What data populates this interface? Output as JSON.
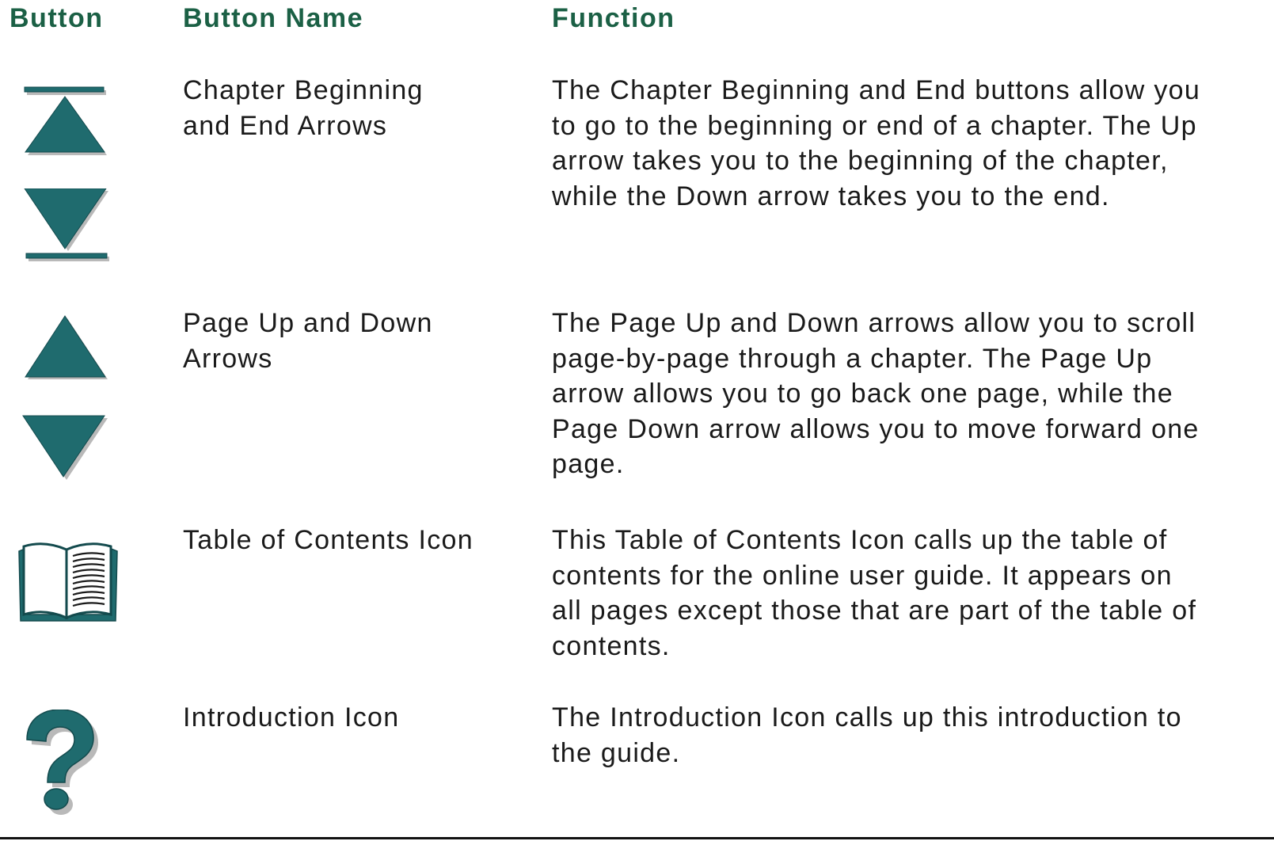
{
  "headers": {
    "button": "Button",
    "name": "Button Name",
    "function": "Function"
  },
  "colors": {
    "header_text": "#1b6045",
    "icon_teal": "#1f6b6e",
    "icon_teal_dark": "#134a4d",
    "icon_shadow": "#b9b9b9"
  },
  "rows": [
    {
      "icons": [
        "chapter-beginning-arrow-icon",
        "chapter-end-arrow-icon"
      ],
      "name_line1": "Chapter Beginning",
      "name_line2": "and End Arrows",
      "function_lines": [
        "The Chapter Beginning and End buttons allow you",
        "to go to the beginning or end of a chapter. The Up",
        "arrow takes you to the beginning of the chapter,",
        "while the Down arrow takes you to the end."
      ]
    },
    {
      "icons": [
        "page-up-arrow-icon",
        "page-down-arrow-icon"
      ],
      "name_line1": "Page Up and Down",
      "name_line2": "Arrows",
      "function_lines": [
        "The Page Up and Down arrows allow you to scroll",
        "page-by-page through a chapter. The Page Up",
        "arrow allows you to go back one page, while the",
        "Page Down arrow allows you to move forward one",
        "page."
      ]
    },
    {
      "icons": [
        "book-icon"
      ],
      "name_line1": "Table of Contents Icon",
      "function_lines": [
        "This Table of Contents Icon calls up the table of",
        "contents for the online user guide. It appears on",
        "all pages except those that are part of the table of",
        "contents."
      ]
    },
    {
      "icons": [
        "question-mark-icon"
      ],
      "name_line1": "Introduction Icon",
      "function_lines": [
        "The Introduction Icon calls up this introduction to",
        "the guide."
      ]
    }
  ]
}
